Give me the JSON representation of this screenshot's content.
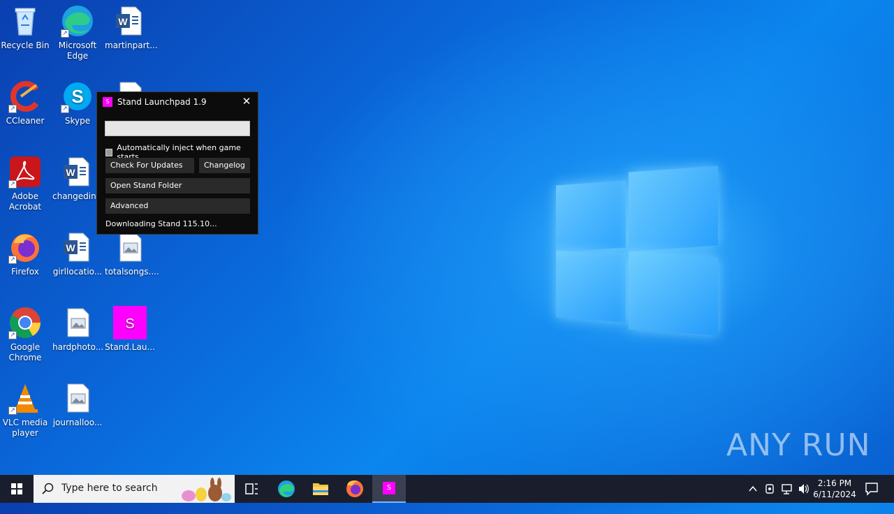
{
  "desktop": {
    "icons": [
      {
        "label": "Recycle Bin"
      },
      {
        "label": "Microsoft Edge"
      },
      {
        "label": "martinpart..."
      },
      {
        "label": "CCleaner"
      },
      {
        "label": "Skype"
      },
      {
        "label": "Adobe Acrobat"
      },
      {
        "label": "changedin..."
      },
      {
        "label": "Firefox"
      },
      {
        "label": "girllocatio..."
      },
      {
        "label": "totalsongs...."
      },
      {
        "label": "Google Chrome"
      },
      {
        "label": "hardphoto..."
      },
      {
        "label": "Stand.Lau..."
      },
      {
        "label": "VLC media player"
      },
      {
        "label": "journalloo..."
      }
    ],
    "watermark": "ANY RUN"
  },
  "stand_window": {
    "app_icon_letter": "S",
    "title": "Stand Launchpad 1.9",
    "close_glyph": "✕",
    "auto_inject_label": "Automatically inject when game starts.",
    "auto_inject_checked": false,
    "check_updates_label": "Check For Updates",
    "changelog_label": "Changelog",
    "open_folder_label": "Open Stand Folder",
    "advanced_label": "Advanced",
    "status_text": "Downloading Stand 115.10...",
    "accent_color": "#ff00ff"
  },
  "taskbar": {
    "search_placeholder": "Type here to search",
    "stand_letter": "S",
    "clock_time": "2:16 PM",
    "clock_date": "6/11/2024"
  }
}
